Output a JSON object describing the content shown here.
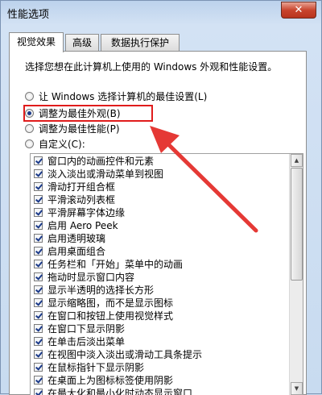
{
  "window": {
    "title": "性能选项",
    "close_glyph": "✕"
  },
  "tabs": [
    {
      "label": "视觉效果",
      "active": true
    },
    {
      "label": "高级",
      "active": false
    },
    {
      "label": "数据执行保护",
      "active": false
    }
  ],
  "panel": {
    "description": "选择您想在此计算机上使用的 Windows 外观和性能设置。",
    "radio_options": [
      {
        "label": "让 Windows 选择计算机的最佳设置(L)",
        "checked": false
      },
      {
        "label": "调整为最佳外观(B)",
        "checked": true
      },
      {
        "label": "调整为最佳性能(P)",
        "checked": false
      },
      {
        "label": "自定义(C):",
        "checked": false
      }
    ],
    "effects": [
      "窗口内的动画控件和元素",
      "淡入淡出或滑动菜单到视图",
      "滑动打开组合框",
      "平滑滚动列表框",
      "平滑屏幕字体边缘",
      "启用 Aero Peek",
      "启用透明玻璃",
      "启用桌面组合",
      "任务栏和「开始」菜单中的动画",
      "拖动时显示窗口内容",
      "显示半透明的选择长方形",
      "显示缩略图，而不是显示图标",
      "在窗口和按钮上使用视觉样式",
      "在窗口下显示阴影",
      "在单击后淡出菜单",
      "在视图中淡入淡出或滑动工具条提示",
      "在鼠标指针下显示阴影",
      "在桌面上为图标标签使用阴影",
      "在最大化和最小化时动态显示窗口"
    ]
  },
  "annotation": {
    "highlight_color": "#e01c1c",
    "arrow_color": "#e53935"
  },
  "scrollbar": {
    "up_glyph": "▲",
    "down_glyph": "▼"
  }
}
